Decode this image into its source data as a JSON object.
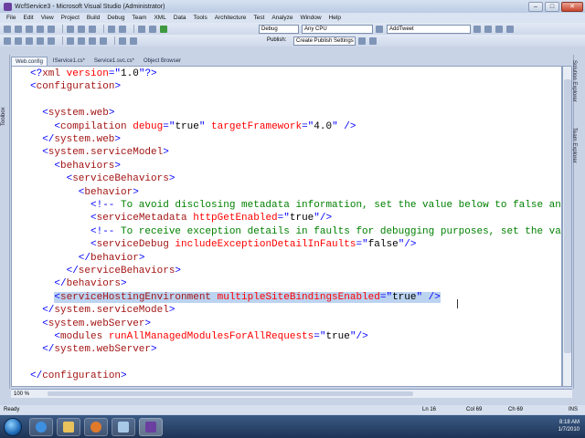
{
  "window": {
    "title": "WcfService3 - Microsoft Visual Studio (Administrator)",
    "buttons": {
      "minimize": "–",
      "maximize": "□",
      "close": "✕"
    }
  },
  "menu": [
    "File",
    "Edit",
    "View",
    "Project",
    "Build",
    "Debug",
    "Team",
    "XML",
    "Data",
    "Tools",
    "Architecture",
    "Test",
    "Analyze",
    "Window",
    "Help"
  ],
  "toolbar": {
    "configuration": "Debug",
    "platform": "Any CPU",
    "find_box": "AddTweet",
    "publish_label": "Publish:",
    "publish_select": "Create Publish Settings"
  },
  "side_panels": {
    "left": "Toolbox",
    "right_top": "Solution Explorer",
    "right_bottom": "Team Explorer"
  },
  "tabs": [
    "Web.config",
    "IService1.cs*",
    "Service1.svc.cs*",
    "Object Browser"
  ],
  "active_tab_index": 0,
  "editor": {
    "lines": [
      {
        "indent": 0,
        "parts": [
          [
            "b",
            "<?"
          ],
          [
            "e",
            "xml"
          ],
          [
            "a",
            " version"
          ],
          [
            "b",
            "=\""
          ],
          [
            "k",
            "1.0"
          ],
          [
            "b",
            "\"?>"
          ]
        ]
      },
      {
        "indent": 0,
        "parts": [
          [
            "b",
            "<"
          ],
          [
            "e",
            "configuration"
          ],
          [
            "b",
            ">"
          ]
        ]
      },
      {
        "indent": 0,
        "parts": []
      },
      {
        "indent": 2,
        "parts": [
          [
            "b",
            "<"
          ],
          [
            "e",
            "system.web"
          ],
          [
            "b",
            ">"
          ]
        ]
      },
      {
        "indent": 4,
        "parts": [
          [
            "b",
            "<"
          ],
          [
            "e",
            "compilation"
          ],
          [
            "a",
            " debug"
          ],
          [
            "b",
            "=\""
          ],
          [
            "k",
            "true"
          ],
          [
            "b",
            "\""
          ],
          [
            "a",
            " targetFramework"
          ],
          [
            "b",
            "=\""
          ],
          [
            "k",
            "4.0"
          ],
          [
            "b",
            "\" />"
          ]
        ]
      },
      {
        "indent": 2,
        "parts": [
          [
            "b",
            "</"
          ],
          [
            "e",
            "system.web"
          ],
          [
            "b",
            ">"
          ]
        ]
      },
      {
        "indent": 2,
        "parts": [
          [
            "b",
            "<"
          ],
          [
            "e",
            "system.serviceModel"
          ],
          [
            "b",
            ">"
          ]
        ]
      },
      {
        "indent": 4,
        "parts": [
          [
            "b",
            "<"
          ],
          [
            "e",
            "behaviors"
          ],
          [
            "b",
            ">"
          ]
        ]
      },
      {
        "indent": 6,
        "parts": [
          [
            "b",
            "<"
          ],
          [
            "e",
            "serviceBehaviors"
          ],
          [
            "b",
            ">"
          ]
        ]
      },
      {
        "indent": 8,
        "parts": [
          [
            "b",
            "<"
          ],
          [
            "e",
            "behavior"
          ],
          [
            "b",
            ">"
          ]
        ]
      },
      {
        "indent": 10,
        "parts": [
          [
            "b",
            "<!--"
          ],
          [
            "c",
            " To avoid disclosing metadata information, set the value below to false and"
          ]
        ]
      },
      {
        "indent": 10,
        "parts": [
          [
            "b",
            "<"
          ],
          [
            "e",
            "serviceMetadata"
          ],
          [
            "a",
            " httpGetEnabled"
          ],
          [
            "b",
            "=\""
          ],
          [
            "k",
            "true"
          ],
          [
            "b",
            "\"/>"
          ]
        ]
      },
      {
        "indent": 10,
        "parts": [
          [
            "b",
            "<!--"
          ],
          [
            "c",
            " To receive exception details in faults for debugging purposes, set the valu"
          ]
        ]
      },
      {
        "indent": 10,
        "parts": [
          [
            "b",
            "<"
          ],
          [
            "e",
            "serviceDebug"
          ],
          [
            "a",
            " includeExceptionDetailInFaults"
          ],
          [
            "b",
            "=\""
          ],
          [
            "k",
            "false"
          ],
          [
            "b",
            "\"/>"
          ]
        ]
      },
      {
        "indent": 8,
        "parts": [
          [
            "b",
            "</"
          ],
          [
            "e",
            "behavior"
          ],
          [
            "b",
            ">"
          ]
        ]
      },
      {
        "indent": 6,
        "parts": [
          [
            "b",
            "</"
          ],
          [
            "e",
            "serviceBehaviors"
          ],
          [
            "b",
            ">"
          ]
        ]
      },
      {
        "indent": 4,
        "parts": [
          [
            "b",
            "</"
          ],
          [
            "e",
            "behaviors"
          ],
          [
            "b",
            ">"
          ]
        ]
      },
      {
        "indent": 4,
        "selected": true,
        "parts": [
          [
            "b",
            "<"
          ],
          [
            "e",
            "serviceHostingEnvironment"
          ],
          [
            "a",
            " multipleSiteBindingsEnabled"
          ],
          [
            "b",
            "=\""
          ],
          [
            "k",
            "true"
          ],
          [
            "b",
            "\" />"
          ]
        ]
      },
      {
        "indent": 2,
        "parts": [
          [
            "b",
            "</"
          ],
          [
            "e",
            "system.serviceModel"
          ],
          [
            "b",
            ">"
          ]
        ]
      },
      {
        "indent": 2,
        "parts": [
          [
            "b",
            "<"
          ],
          [
            "e",
            "system.webServer"
          ],
          [
            "b",
            ">"
          ]
        ]
      },
      {
        "indent": 4,
        "parts": [
          [
            "b",
            "<"
          ],
          [
            "e",
            "modules"
          ],
          [
            "a",
            " runAllManagedModulesForAllRequests"
          ],
          [
            "b",
            "=\""
          ],
          [
            "k",
            "true"
          ],
          [
            "b",
            "\"/>"
          ]
        ]
      },
      {
        "indent": 2,
        "parts": [
          [
            "b",
            "</"
          ],
          [
            "e",
            "system.webServer"
          ],
          [
            "b",
            ">"
          ]
        ]
      },
      {
        "indent": 0,
        "parts": []
      },
      {
        "indent": 0,
        "parts": [
          [
            "b",
            "</"
          ],
          [
            "e",
            "configuration"
          ],
          [
            "b",
            ">"
          ]
        ]
      }
    ]
  },
  "zoom": "100 %",
  "status": {
    "ready": "Ready",
    "ln": "Ln 16",
    "col": "Col 69",
    "ch": "Ch 69",
    "mode": "INS"
  },
  "taskbar": {
    "apps": [
      "ie-icon",
      "explorer-icon",
      "media-player-icon",
      "paint-icon",
      "visual-studio-icon"
    ],
    "clock_time": "8:18 AM",
    "clock_date": "1/7/2010"
  },
  "colors": {
    "tag_bracket": "#0000ff",
    "element": "#a31515",
    "attribute": "#ff0000",
    "comment": "#008000",
    "selection": "#bcd3f0"
  }
}
